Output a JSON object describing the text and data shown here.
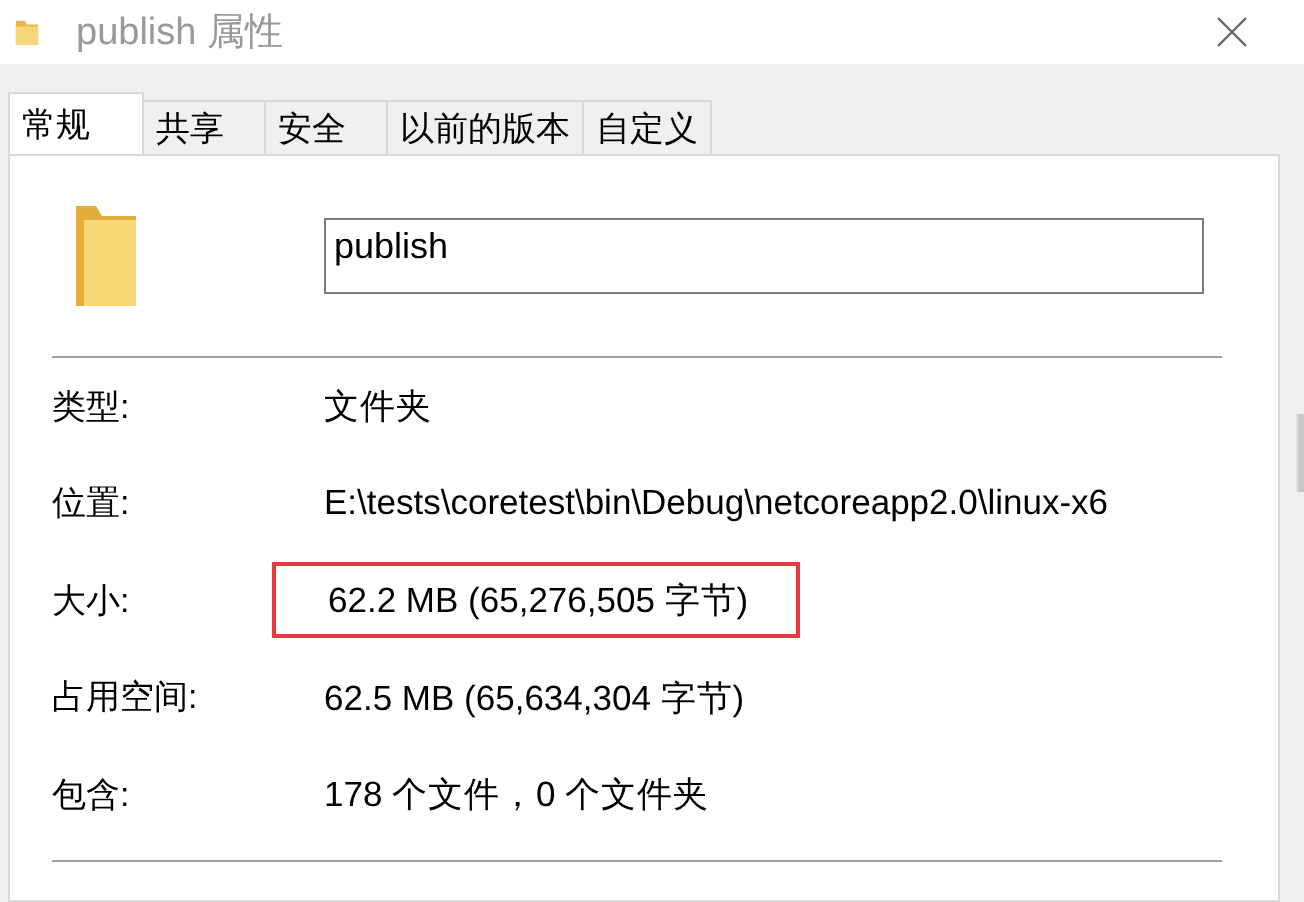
{
  "window": {
    "title": "publish 属性"
  },
  "tabs": [
    {
      "label": "常规",
      "selected": true
    },
    {
      "label": "共享",
      "selected": false
    },
    {
      "label": "安全",
      "selected": false
    },
    {
      "label": "以前的版本",
      "selected": false
    },
    {
      "label": "自定义",
      "selected": false
    }
  ],
  "name_field": {
    "value": "publish"
  },
  "properties": [
    {
      "label": "类型:",
      "value": "文件夹",
      "highlighted": false
    },
    {
      "label": "位置:",
      "value": "E:\\tests\\coretest\\bin\\Debug\\netcoreapp2.0\\linux-x6",
      "highlighted": false
    },
    {
      "label": "大小:",
      "value": "62.2 MB (65,276,505 字节)",
      "highlighted": true
    },
    {
      "label": "占用空间:",
      "value": "62.5 MB (65,634,304 字节)",
      "highlighted": false
    },
    {
      "label": "包含:",
      "value": "178 个文件，0 个文件夹",
      "highlighted": false
    }
  ]
}
